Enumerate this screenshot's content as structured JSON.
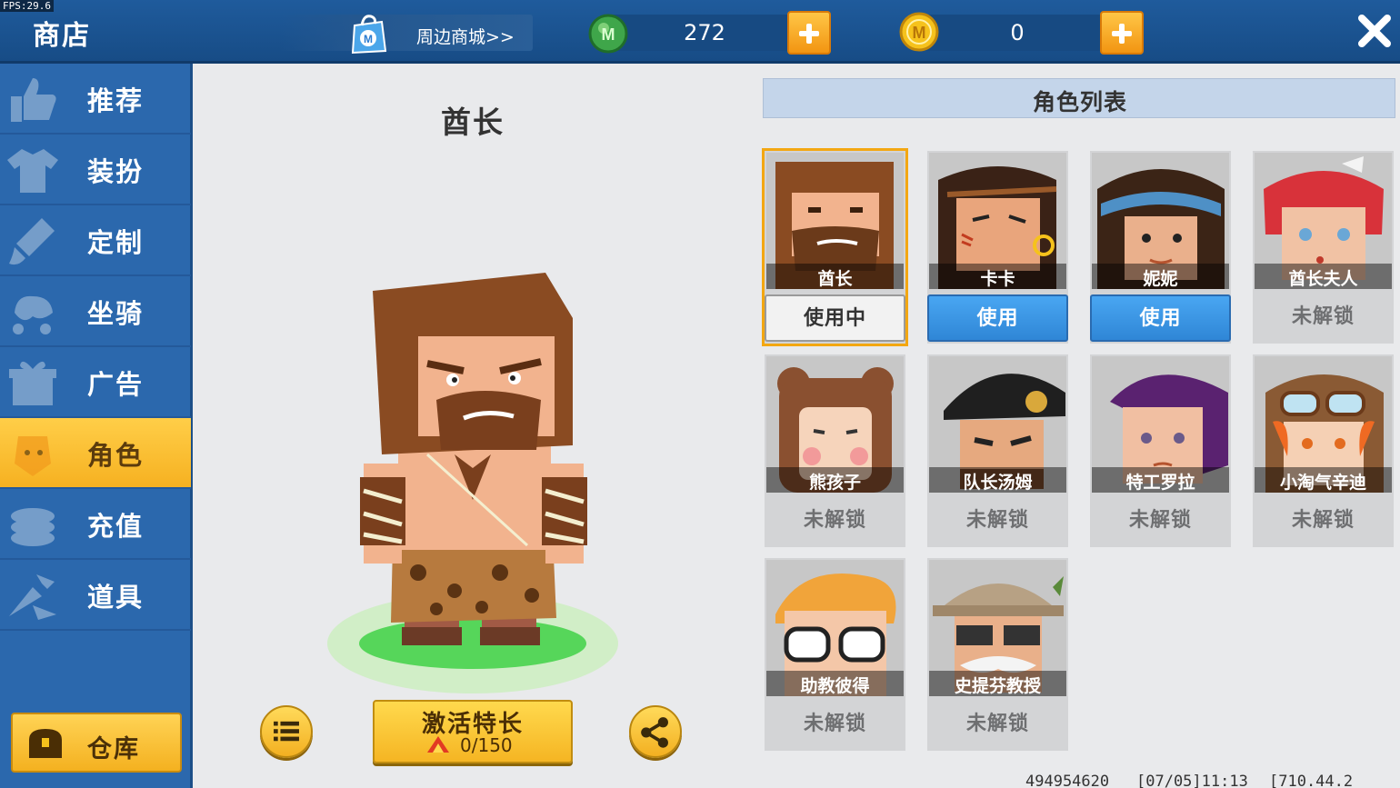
{
  "fps": "FPS:29.6",
  "header": {
    "title": "商店",
    "store_link": "周边商城>>",
    "mini_coins": "272",
    "gold_coins": "0"
  },
  "sidebar": {
    "items": [
      {
        "label": "推荐",
        "icon": "thumbs-up-icon"
      },
      {
        "label": "装扮",
        "icon": "shirt-icon"
      },
      {
        "label": "定制",
        "icon": "brush-icon"
      },
      {
        "label": "坐骑",
        "icon": "mount-icon"
      },
      {
        "label": "广告",
        "icon": "gift-icon"
      },
      {
        "label": "角色",
        "icon": "character-icon"
      },
      {
        "label": "充值",
        "icon": "coins-icon"
      },
      {
        "label": "道具",
        "icon": "tools-icon"
      }
    ],
    "active_index": 5,
    "warehouse": "仓库"
  },
  "preview": {
    "name": "酋长",
    "activate_label": "激活特长",
    "activate_progress": "0/150"
  },
  "list": {
    "title": "角色列表",
    "characters": [
      {
        "name": "酋长",
        "action": "使用中",
        "state": "inuse"
      },
      {
        "name": "卡卡",
        "action": "使用",
        "state": "use"
      },
      {
        "name": "妮妮",
        "action": "使用",
        "state": "use"
      },
      {
        "name": "酋长夫人",
        "action": "未解锁",
        "state": "locked"
      },
      {
        "name": "熊孩子",
        "action": "未解锁",
        "state": "locked"
      },
      {
        "name": "队长汤姆",
        "action": "未解锁",
        "state": "locked"
      },
      {
        "name": "特工罗拉",
        "action": "未解锁",
        "state": "locked"
      },
      {
        "name": "小淘气辛迪",
        "action": "未解锁",
        "state": "locked"
      },
      {
        "name": "助教彼得",
        "action": "未解锁",
        "state": "locked"
      },
      {
        "name": "史提芬教授",
        "action": "未解锁",
        "state": "locked"
      }
    ]
  },
  "footer": {
    "uid": "494954620",
    "date": "[07/05]11:13",
    "version": "[710.44.2"
  },
  "colors": {
    "topbar": "#1f5b9c",
    "sidebar": "#2b68ad",
    "active_tab": "#ffce48",
    "use_button": "#3b97e6",
    "plus_button": "#f5a623"
  }
}
